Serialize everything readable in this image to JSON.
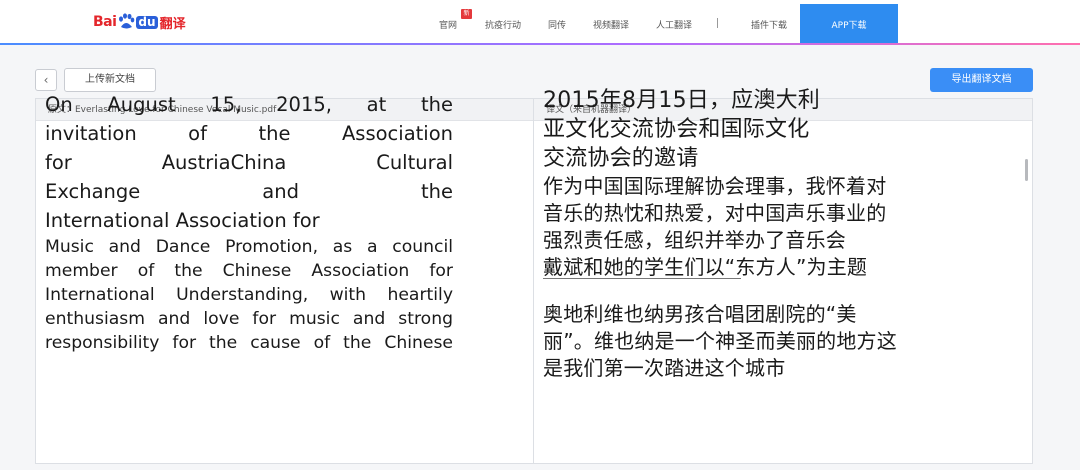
{
  "logo": {
    "bai": "Bai",
    "du": "du",
    "fanyi": "翻译"
  },
  "nav": {
    "items": [
      "官网",
      "抗疫行动",
      "同传",
      "视频翻译",
      "人工翻译",
      "插件下载"
    ],
    "new_badge": "新",
    "app_download": "APP下载"
  },
  "toolbar": {
    "back_icon": "‹",
    "upload_label": "上传新文档",
    "export_label": "导出翻译文档"
  },
  "source_panel": {
    "header": "原文：Everlasting Love for Chinese Vocal Music.pdf",
    "lines_large": [
      "On August 15, 2015, at the",
      "invitation of the Association",
      "for AustriaChina Cultural",
      "Exchange and the",
      "International Association for"
    ],
    "lines_small": [
      "Music and Dance Promotion, as a council",
      "member of the Chinese Association for",
      "International Understanding, with heartily",
      "enthusiasm and love for music and strong",
      "responsibility for the cause of the Chinese"
    ]
  },
  "target_panel": {
    "header": "译文（来自机器翻译）",
    "lines_large": [
      "2015年8月15日，应澳大利",
      "亚文化交流协会和国际文化",
      "交流协会的邀请"
    ],
    "lines_mid": [
      "作为中国国际理解协会理事，我怀着对",
      "音乐的热忱和热爱，对中国声乐事业的",
      "强烈责任感，组织并举办了音乐会",
      "戴斌和她的学生们以“东方人”为主题"
    ],
    "lines_after": [
      "奥地利维也纳男孩合唱团剧院的“美",
      "丽”。维也纳是一个神圣而美丽的地方这",
      "是我们第一次踏进这个城市"
    ]
  },
  "colors": {
    "accent": "#3a8ef6",
    "app_button": "#2e8cf0",
    "brand_red": "#e4262b",
    "brand_blue": "#2a5fd9"
  }
}
